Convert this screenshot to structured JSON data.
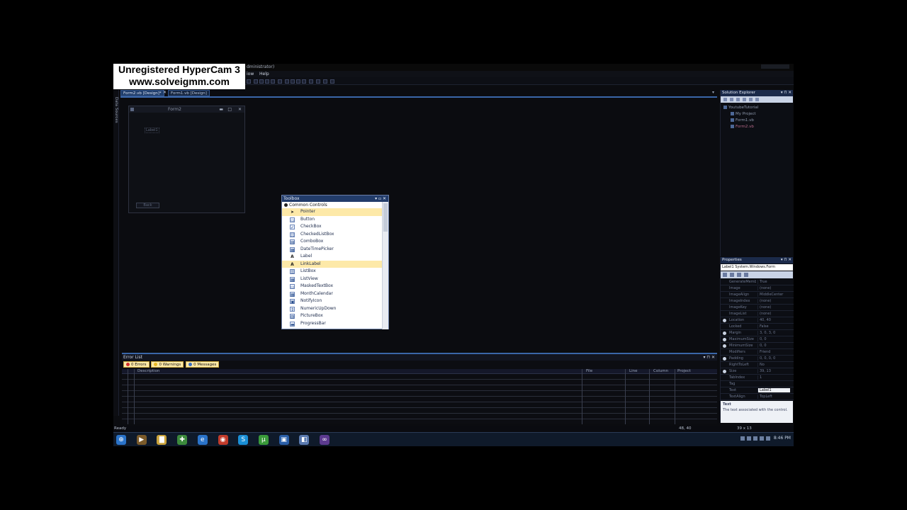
{
  "watermark": {
    "line1": "Unregistered HyperCam 3",
    "line2": "www.solveigmm.com"
  },
  "window": {
    "title_fragment": "dministrator)"
  },
  "menu": {
    "items": [
      "iow",
      "Help"
    ]
  },
  "doc_tabs": [
    {
      "label": "Form2.vb [Design]*",
      "active": true
    },
    {
      "label": "Form1.vb [Design]",
      "active": false
    }
  ],
  "left_strip": {
    "label": "Data Sources"
  },
  "designer": {
    "form_title": "Form2",
    "form_controls": {
      "min": "▬",
      "max": "□",
      "close": "✕"
    },
    "label_text": "Label1",
    "button_text": "Back"
  },
  "toolbox": {
    "title": "Toolbox",
    "controls": "▾ ▫ ✕",
    "group": "Common Controls",
    "items": [
      {
        "label": "Pointer",
        "icon": "pointer-icon",
        "glyph": "➤",
        "selected": true
      },
      {
        "label": "Button",
        "icon": "button-icon",
        "glyph": "▭",
        "selected": false
      },
      {
        "label": "CheckBox",
        "icon": "checkbox-icon",
        "glyph": "✓",
        "selected": false
      },
      {
        "label": "CheckedListBox",
        "icon": "checkedlistbox-icon",
        "glyph": "☷",
        "selected": false
      },
      {
        "label": "ComboBox",
        "icon": "combobox-icon",
        "glyph": "▤",
        "selected": false
      },
      {
        "label": "DateTimePicker",
        "icon": "datetimepicker-icon",
        "glyph": "▦",
        "selected": false
      },
      {
        "label": "Label",
        "icon": "label-icon",
        "glyph": "A",
        "selected": false
      },
      {
        "label": "LinkLabel",
        "icon": "linklabel-icon",
        "glyph": "A",
        "selected": true
      },
      {
        "label": "ListBox",
        "icon": "listbox-icon",
        "glyph": "☰",
        "selected": false
      },
      {
        "label": "ListView",
        "icon": "listview-icon",
        "glyph": "▦",
        "selected": false
      },
      {
        "label": "MaskedTextBox",
        "icon": "maskedtextbox-icon",
        "glyph": "▭",
        "selected": false
      },
      {
        "label": "MonthCalendar",
        "icon": "monthcalendar-icon",
        "glyph": "▦",
        "selected": false
      },
      {
        "label": "NotifyIcon",
        "icon": "notifyicon-icon",
        "glyph": "▣",
        "selected": false
      },
      {
        "label": "NumericUpDown",
        "icon": "numericupdown-icon",
        "glyph": "⇕",
        "selected": false
      },
      {
        "label": "PictureBox",
        "icon": "picturebox-icon",
        "glyph": "▨",
        "selected": false
      },
      {
        "label": "ProgressBar",
        "icon": "progressbar-icon",
        "glyph": "▬",
        "selected": false
      }
    ]
  },
  "error_list": {
    "title": "Error List",
    "controls": "▾ ⊓ ✕",
    "filters": [
      {
        "label": "0 Errors",
        "color": "#d22c2c"
      },
      {
        "label": "0 Warnings",
        "color": "#e7b622"
      },
      {
        "label": "0 Messages",
        "color": "#3a6fc2"
      }
    ],
    "columns": [
      "Description",
      "File",
      "Line",
      "Column",
      "Project"
    ]
  },
  "solution_explorer": {
    "title": "Solution Explorer",
    "controls": "▾ ⊓ ✕",
    "tree": [
      {
        "label": "YoutubeTutorial",
        "indent": 0,
        "selected": false
      },
      {
        "label": "My Project",
        "indent": 1,
        "selected": false
      },
      {
        "label": "Form1.vb",
        "indent": 1,
        "selected": false
      },
      {
        "label": "Form2.vb",
        "indent": 1,
        "selected": true
      }
    ]
  },
  "properties": {
    "title": "Properties",
    "controls": "▾ ⊓ ✕",
    "object": "Label1 System.Windows.Form",
    "rows": [
      {
        "name": "GenerateMember",
        "value": "True",
        "dot": false,
        "selected": false
      },
      {
        "name": "Image",
        "value": "(none)",
        "dot": false,
        "selected": false
      },
      {
        "name": "ImageAlign",
        "value": "MiddleCenter",
        "dot": false,
        "selected": false
      },
      {
        "name": "ImageIndex",
        "value": "(none)",
        "dot": false,
        "selected": false
      },
      {
        "name": "ImageKey",
        "value": "(none)",
        "dot": false,
        "selected": false
      },
      {
        "name": "ImageList",
        "value": "(none)",
        "dot": false,
        "selected": false
      },
      {
        "name": "Location",
        "value": "40, 40",
        "dot": true,
        "selected": false
      },
      {
        "name": "Locked",
        "value": "False",
        "dot": false,
        "selected": false
      },
      {
        "name": "Margin",
        "value": "3, 0, 3, 0",
        "dot": true,
        "selected": false
      },
      {
        "name": "MaximumSize",
        "value": "0, 0",
        "dot": true,
        "selected": false
      },
      {
        "name": "MinimumSize",
        "value": "0, 0",
        "dot": true,
        "selected": false
      },
      {
        "name": "Modifiers",
        "value": "Friend",
        "dot": false,
        "selected": false
      },
      {
        "name": "Padding",
        "value": "0, 0, 0, 0",
        "dot": true,
        "selected": false
      },
      {
        "name": "RightToLeft",
        "value": "No",
        "dot": false,
        "selected": false
      },
      {
        "name": "Size",
        "value": "39, 13",
        "dot": true,
        "selected": false
      },
      {
        "name": "TabIndex",
        "value": "1",
        "dot": false,
        "selected": false
      },
      {
        "name": "Tag",
        "value": "",
        "dot": false,
        "selected": false
      },
      {
        "name": "Text",
        "value": "Label1",
        "dot": false,
        "selected": true
      },
      {
        "name": "TextAlign",
        "value": "TopLeft",
        "dot": false,
        "selected": false
      }
    ],
    "desc_title": "Text",
    "desc_text": "The text associated with the control."
  },
  "status": {
    "ready": "Ready",
    "pos": "48, 40",
    "size": "39 x 13"
  },
  "taskbar": {
    "items": [
      {
        "icon": "start-orb-icon",
        "glyph": "⊕",
        "color": "#2a73c9"
      },
      {
        "icon": "media-player-icon",
        "glyph": "▶",
        "color": "#7a5a2a"
      },
      {
        "icon": "folder-icon",
        "glyph": "▇",
        "color": "#c9a23a"
      },
      {
        "icon": "network-icon",
        "glyph": "✚",
        "color": "#3c8a3c"
      },
      {
        "icon": "ie-icon",
        "glyph": "e",
        "color": "#2a73c9"
      },
      {
        "icon": "chrome-icon",
        "glyph": "◉",
        "color": "#c23b2b"
      },
      {
        "icon": "skype-icon",
        "glyph": "S",
        "color": "#1a8fd6"
      },
      {
        "icon": "utorrent-icon",
        "glyph": "µ",
        "color": "#3a9a3a"
      },
      {
        "icon": "app-icon",
        "glyph": "▣",
        "color": "#2a5fa8"
      },
      {
        "icon": "paint-icon",
        "glyph": "◧",
        "color": "#5a7ab0"
      },
      {
        "icon": "visual-studio-icon",
        "glyph": "∞",
        "color": "#5c3a8f"
      }
    ],
    "clock": "8:46 PM"
  }
}
